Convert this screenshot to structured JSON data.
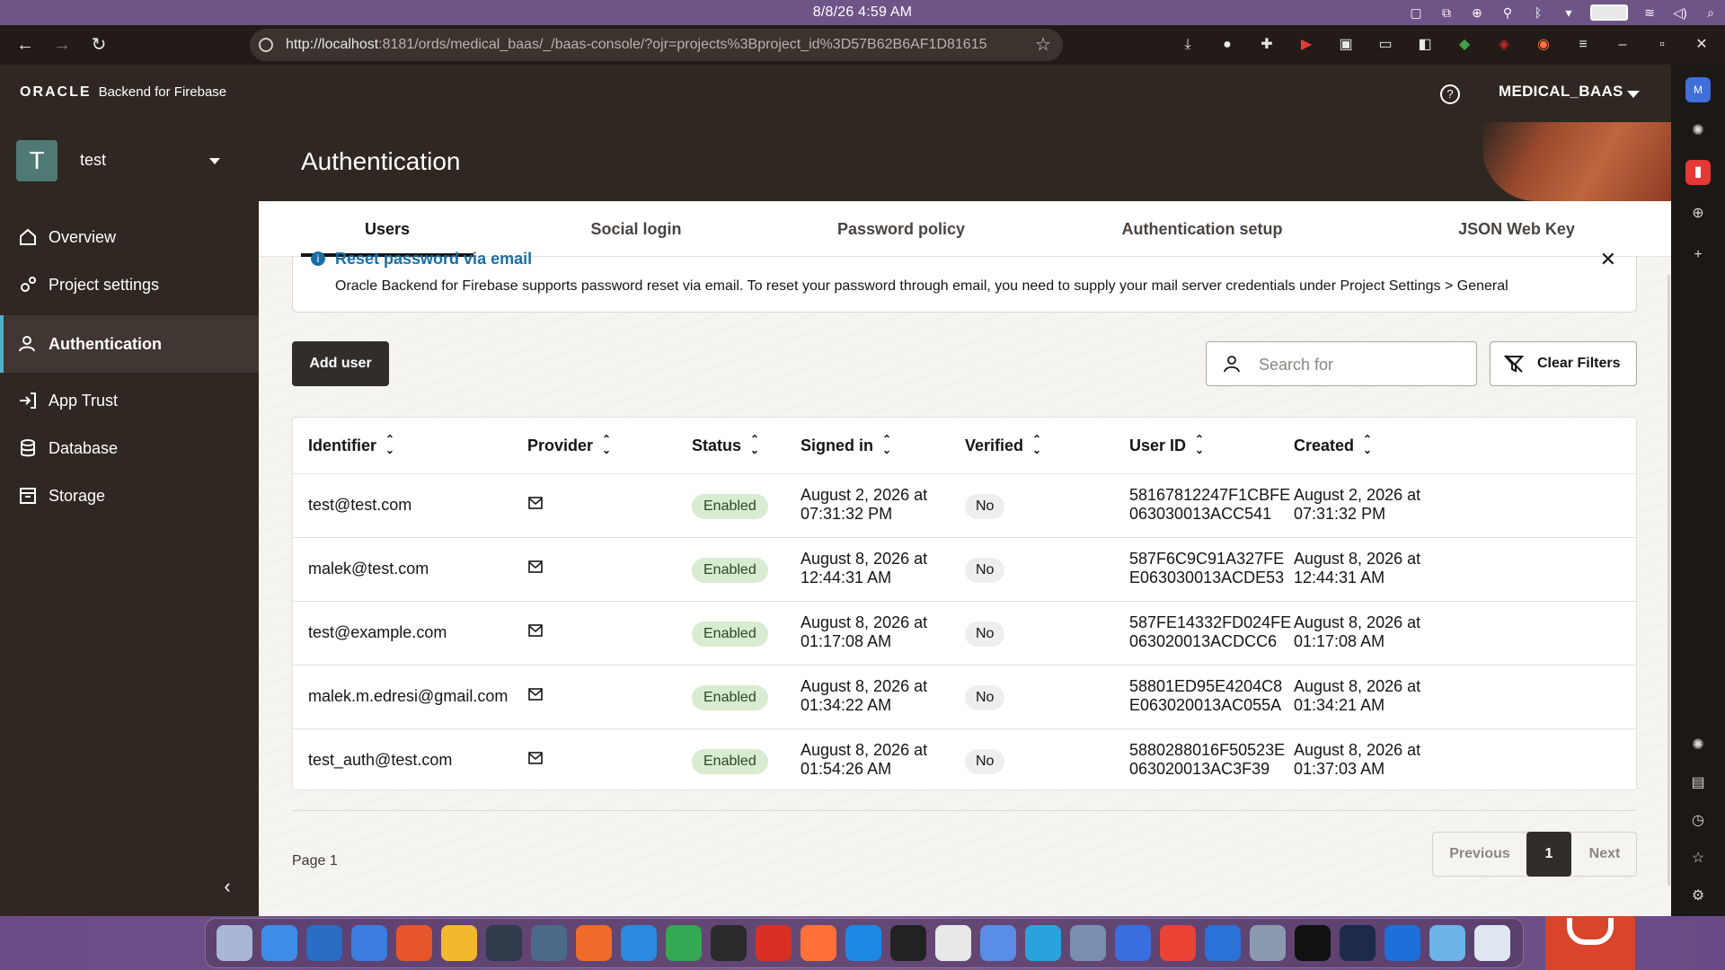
{
  "os": {
    "clock": "8/8/26   4:59 AM"
  },
  "browser": {
    "url_host": "http://localhost",
    "url_rest": ":8181/ords/medical_baas/_/baas-console/?ojr=projects%3Bproject_id%3D57B62B6AF1D81615"
  },
  "header": {
    "brand_oracle": "ORACLE",
    "brand_product": "Backend for Firebase",
    "help": "?",
    "user": "MEDICAL_BAAS"
  },
  "sidebar": {
    "project_initial": "T",
    "project_name": "test",
    "items": [
      {
        "label": "Overview",
        "icon": "home-icon"
      },
      {
        "label": "Project settings",
        "icon": "gears-icon"
      },
      {
        "label": "Authentication",
        "icon": "user-icon"
      },
      {
        "label": "App Trust",
        "icon": "sign-in-icon"
      },
      {
        "label": "Database",
        "icon": "database-icon"
      },
      {
        "label": "Storage",
        "icon": "storage-icon"
      }
    ],
    "active_item": "Authentication",
    "collapse": "‹"
  },
  "page": {
    "title": "Authentication"
  },
  "tabs": [
    {
      "label": "Users",
      "active": true
    },
    {
      "label": "Social login",
      "active": false
    },
    {
      "label": "Password policy",
      "active": false
    },
    {
      "label": "Authentication setup",
      "active": false
    },
    {
      "label": "JSON Web Key",
      "active": false
    }
  ],
  "banner": {
    "title": "Reset password via email",
    "text": "Oracle Backend for Firebase supports password reset via email. To reset your password through email, you need to supply your mail server credentials under Project Settings > General"
  },
  "toolbar": {
    "add_user": "Add user",
    "search_placeholder": "Search for",
    "clear_filters": "Clear Filters"
  },
  "table": {
    "columns": [
      "Identifier",
      "Provider",
      "Status",
      "Signed in",
      "Verified",
      "User ID",
      "Created"
    ],
    "rows": [
      {
        "identifier": "test@test.com",
        "provider": "email",
        "status": "Enabled",
        "signed_in_1": "August 2, 2026 at",
        "signed_in_2": "07:31:32 PM",
        "verified": "No",
        "user_id_1": "58167812247F1CBFE",
        "user_id_2": "063030013ACC541",
        "created_1": "August 2, 2026 at",
        "created_2": "07:31:32 PM"
      },
      {
        "identifier": "malek@test.com",
        "provider": "email",
        "status": "Enabled",
        "signed_in_1": "August 8, 2026 at",
        "signed_in_2": "12:44:31 AM",
        "verified": "No",
        "user_id_1": "587F6C9C91A327FE",
        "user_id_2": "E063030013ACDE53",
        "created_1": "August 8, 2026 at",
        "created_2": "12:44:31 AM"
      },
      {
        "identifier": "test@example.com",
        "provider": "email",
        "status": "Enabled",
        "signed_in_1": "August 8, 2026 at",
        "signed_in_2": "01:17:08 AM",
        "verified": "No",
        "user_id_1": "587FE14332FD024FE",
        "user_id_2": "063020013ACDCC6",
        "created_1": "August 8, 2026 at",
        "created_2": "01:17:08 AM"
      },
      {
        "identifier": "malek.m.edresi@gmail.com",
        "provider": "email",
        "status": "Enabled",
        "signed_in_1": "August 8, 2026 at",
        "signed_in_2": "01:34:22 AM",
        "verified": "No",
        "user_id_1": "58801ED95E4204C8",
        "user_id_2": "E063020013AC055A",
        "created_1": "August 8, 2026 at",
        "created_2": "01:34:21 AM"
      },
      {
        "identifier": "test_auth@test.com",
        "provider": "email",
        "status": "Enabled",
        "signed_in_1": "August 8, 2026 at",
        "signed_in_2": "01:54:26 AM",
        "verified": "No",
        "user_id_1": "5880288016F50523E",
        "user_id_2": "063020013AC3F39",
        "created_1": "August 8, 2026 at",
        "created_2": "01:37:03 AM"
      }
    ]
  },
  "pagination": {
    "label": "Page 1",
    "previous": "Previous",
    "current": "1",
    "next": "Next"
  },
  "colors": {
    "header_bg": "#2f2722",
    "active_accent": "#4fb3c7",
    "enabled_badge": "#d9ebd0",
    "primary_button": "#312d2a"
  }
}
